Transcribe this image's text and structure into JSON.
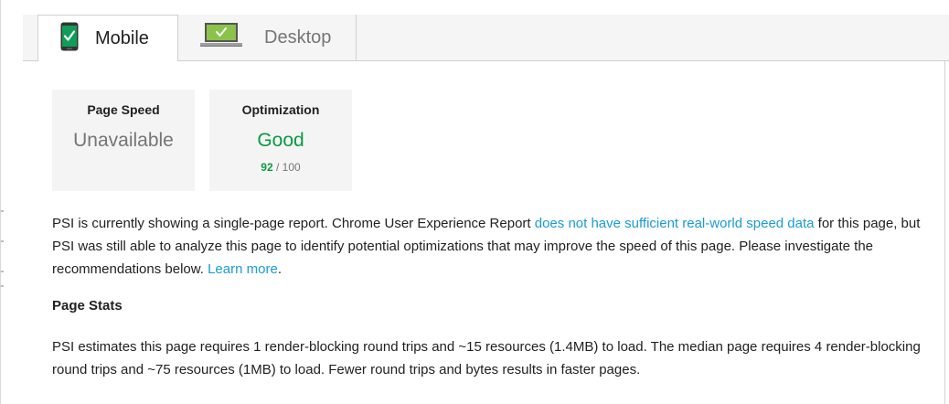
{
  "tabs": {
    "mobile": {
      "label": "Mobile",
      "icon": "phone-check-icon",
      "selected": true
    },
    "desktop": {
      "label": "Desktop",
      "icon": "laptop-check-icon",
      "selected": false
    }
  },
  "cards": {
    "page_speed": {
      "title": "Page Speed",
      "value": "Unavailable"
    },
    "optimization": {
      "title": "Optimization",
      "value": "Good",
      "score": "92",
      "score_suffix": " / 100"
    }
  },
  "report": {
    "text_before_link": "PSI is currently showing a single-page report. Chrome User Experience Report ",
    "link_crux": "does not have sufficient real-world speed data",
    "text_after_link": " for this page, but PSI was still able to analyze this page to identify potential optimizations that may improve the speed of this page. Please investigate the recommendations below. ",
    "learn_more": "Learn more",
    "end": "."
  },
  "page_stats": {
    "heading": "Page Stats",
    "text": "PSI estimates this page requires 1 render-blocking round trips and ~15 resources (1.4MB) to load. The median page requires 4 render-blocking round trips and ~75 resources (1MB) to load. Fewer round trips and bytes results in faster pages."
  },
  "colors": {
    "good": "#0a9a40",
    "link": "#1a9bd7",
    "icon_green": "#0f9d58",
    "icon_desktop_green": "#8bc34a"
  }
}
